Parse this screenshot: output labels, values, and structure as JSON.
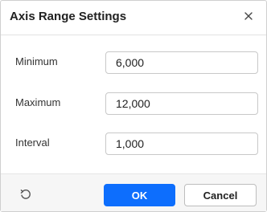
{
  "dialog": {
    "title": "Axis Range Settings",
    "close_icon": "close-icon"
  },
  "fields": {
    "minimum": {
      "label": "Minimum",
      "value": "6,000"
    },
    "maximum": {
      "label": "Maximum",
      "value": "12,000"
    },
    "interval": {
      "label": "Interval",
      "value": "1,000"
    }
  },
  "footer": {
    "reset_icon": "reset-icon",
    "ok_label": "OK",
    "cancel_label": "Cancel"
  },
  "colors": {
    "primary": "#0d6efd",
    "footer_bg": "#f6f6f6",
    "border": "#c8c8c8"
  }
}
